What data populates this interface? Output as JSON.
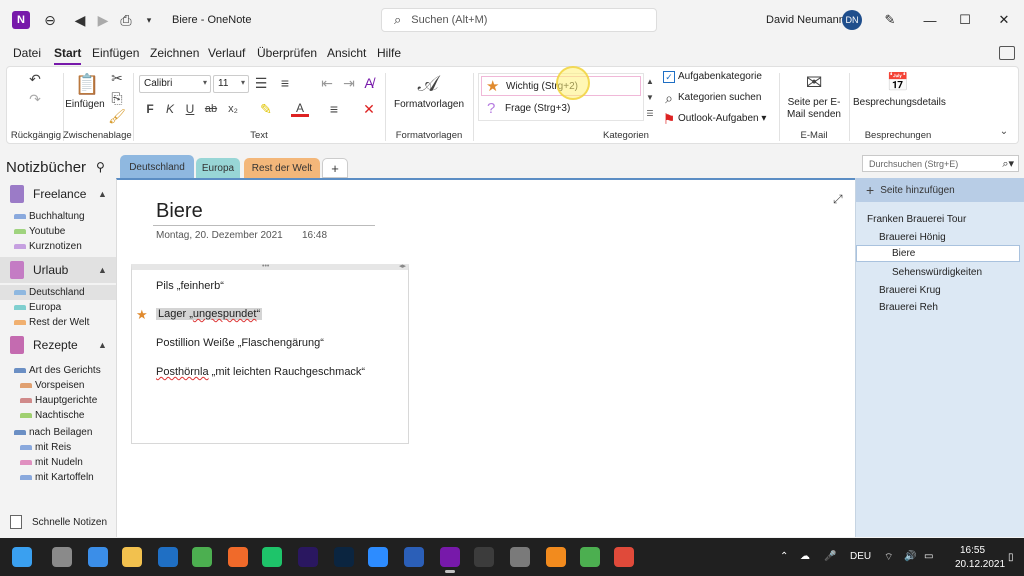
{
  "window": {
    "title": "Biere  -  OneNote",
    "app_logo": "N",
    "search_placeholder": "Suchen (Alt+M)",
    "user_name": "David Neumann",
    "user_initials": "DN"
  },
  "menu": [
    "Datei",
    "Start",
    "Einfügen",
    "Zeichnen",
    "Verlauf",
    "Überprüfen",
    "Ansicht",
    "Hilfe"
  ],
  "ribbon": {
    "groups": {
      "undo": "Rückgängig",
      "clipboard": "Zwischenablage",
      "text": "Text",
      "styles": "Formatvorlagen",
      "tags": "Kategorien",
      "email": "E-Mail",
      "meetings": "Besprechungen"
    },
    "paste_label": "Einfügen",
    "font_name": "Calibri",
    "font_size": "11",
    "styles_button": "Formatvorlagen",
    "tag_important": "Wichtig (Strg+2)",
    "tag_question": "Frage (Strg+3)",
    "todo_tag": "Aufgabenkategorie",
    "find_tags": "Kategorien suchen",
    "outlook_tasks": "Outlook-Aufgaben",
    "email_page": "Seite per E-Mail senden",
    "meeting_details": "Besprechungsdetails"
  },
  "nav": {
    "title": "Notizbücher",
    "notebooks": [
      {
        "name": "Freelance",
        "color": "#9b7bc7",
        "sections": [
          {
            "label": "Buchhaltung",
            "color": "#8aa9dd"
          },
          {
            "label": "Youtube",
            "color": "#9fd37e"
          },
          {
            "label": "Kurznotizen",
            "color": "#c6a0e0"
          }
        ]
      },
      {
        "name": "Urlaub",
        "color": "#c47cc4",
        "sections": [
          {
            "label": "Deutschland",
            "color": "#8fb8e0"
          },
          {
            "label": "Europa",
            "color": "#7fcfcf"
          },
          {
            "label": "Rest der Welt",
            "color": "#f0b070"
          }
        ]
      },
      {
        "name": "Rezepte",
        "color": "#c46bb0",
        "sections": [
          {
            "label": "Art des Gerichts",
            "color": "#6b8fc4"
          },
          {
            "label": "Vorspeisen",
            "color": "#e0a070"
          },
          {
            "label": "Hauptgerichte",
            "color": "#d08a8a"
          },
          {
            "label": "Nachtische",
            "color": "#a0d070"
          },
          {
            "label": "nach Beilagen",
            "color": "#6b8fc4"
          },
          {
            "label": "mit Reis",
            "color": "#8aa9dd"
          },
          {
            "label": "mit Nudeln",
            "color": "#e090c0"
          },
          {
            "label": "mit Kartoffeln",
            "color": "#8aa9dd"
          }
        ]
      }
    ],
    "quick_notes": "Schnelle Notizen"
  },
  "section_tabs": [
    {
      "label": "Deutschland",
      "color": "#8fb8e0"
    },
    {
      "label": "Europa",
      "color": "#98d6d6"
    },
    {
      "label": "Rest der Welt",
      "color": "#f3b77a"
    }
  ],
  "page_search_placeholder": "Durchsuchen (Strg+E)",
  "page": {
    "title": "Biere",
    "date": "Montag, 20. Dezember 2021",
    "time": "16:48",
    "lines": [
      {
        "text": "Pils „feinherb“"
      },
      {
        "prefix": "Lager „",
        "squiggle": "ungespundet",
        "suffix": "“"
      },
      {
        "text": "Postillion Weiße „Flaschengärung“"
      },
      {
        "squiggle": "Posthörnla",
        "suffix": "  „mit leichten Rauchgeschmack“"
      }
    ]
  },
  "pages_panel": {
    "add_label": "Seite hinzufügen",
    "pages": [
      {
        "label": "Franken Brauerei Tour",
        "level": 0
      },
      {
        "label": "Brauerei Hönig",
        "level": 1
      },
      {
        "label": "Biere",
        "level": 2
      },
      {
        "label": "Sehenswürdigkeiten",
        "level": 2
      },
      {
        "label": "Brauerei Krug",
        "level": 1
      },
      {
        "label": "Brauerei Reh",
        "level": 1
      }
    ]
  },
  "taskbar": {
    "apps": [
      {
        "name": "start-icon",
        "color": "#3aa0f0"
      },
      {
        "name": "task-view-icon",
        "color": "#8a8a8a"
      },
      {
        "name": "widgets-icon",
        "color": "#3b8ee8"
      },
      {
        "name": "file-explorer-icon",
        "color": "#f2c14e"
      },
      {
        "name": "outlook-icon",
        "color": "#1f6fc4"
      },
      {
        "name": "chrome-icon",
        "color": "#4caf50"
      },
      {
        "name": "firefox-icon",
        "color": "#f06a2a"
      },
      {
        "name": "checkmark-app-icon",
        "color": "#1ec46a"
      },
      {
        "name": "premiere-icon",
        "color": "#2a1760"
      },
      {
        "name": "lightroom-icon",
        "color": "#0b2540"
      },
      {
        "name": "zoom-icon",
        "color": "#2d8cff"
      },
      {
        "name": "word-icon",
        "color": "#2b5fb8"
      },
      {
        "name": "onenote-icon",
        "color": "#7719aa"
      },
      {
        "name": "obs-icon",
        "color": "#3c3c3c"
      },
      {
        "name": "settings-icon",
        "color": "#7a7a7a"
      },
      {
        "name": "vlc-icon",
        "color": "#f28b1e"
      },
      {
        "name": "chrome-profile-icon",
        "color": "#4caf50"
      },
      {
        "name": "chrome-alt-icon",
        "color": "#e04a3a"
      }
    ],
    "tray_lang": "DEU",
    "time": "16:55",
    "date": "20.12.2021"
  }
}
